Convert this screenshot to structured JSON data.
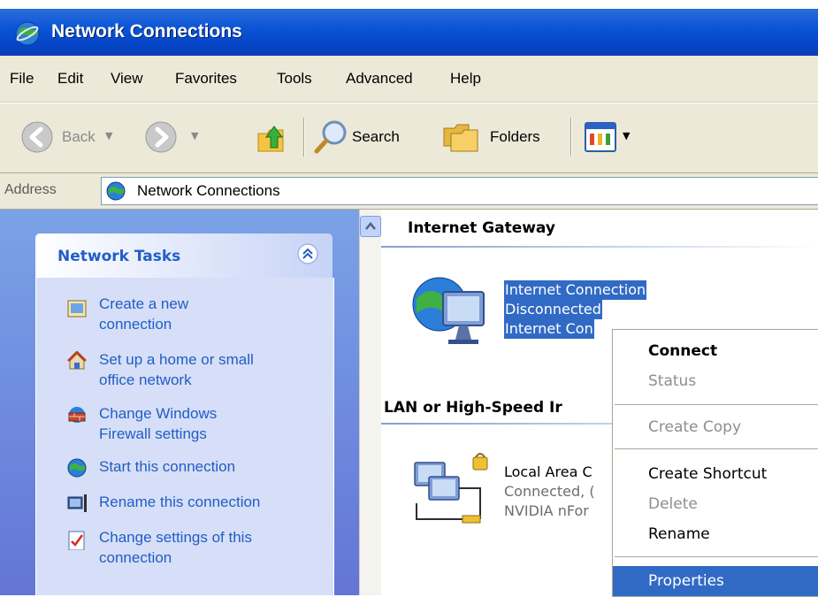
{
  "window": {
    "title": "Network Connections"
  },
  "menu": [
    "File",
    "Edit",
    "View",
    "Favorites",
    "Tools",
    "Advanced",
    "Help"
  ],
  "toolbar": {
    "back": "Back",
    "search": "Search",
    "folders": "Folders"
  },
  "address": {
    "label": "Address",
    "value": "Network Connections"
  },
  "tasks": {
    "title": "Network Tasks",
    "items": [
      {
        "line1": "Create a new",
        "line2": "connection"
      },
      {
        "line1": "Set up a home or small",
        "line2": "office network"
      },
      {
        "line1": "Change Windows",
        "line2": "Firewall settings"
      },
      {
        "line1": "Start this connection",
        "line2": ""
      },
      {
        "line1": "Rename this connection",
        "line2": ""
      },
      {
        "line1": "Change settings of this",
        "line2": "connection"
      }
    ]
  },
  "content": {
    "group1": "Internet Gateway",
    "gateway": {
      "line1": "Internet Connection",
      "line2": "Disconnected",
      "line3": "Internet Con"
    },
    "group2": "LAN or High-Speed Ir",
    "lan": {
      "line1": "Local Area C",
      "line2": "Connected, (",
      "line3": "NVIDIA nFor"
    }
  },
  "context_menu": {
    "connect": "Connect",
    "status": "Status",
    "create_copy": "Create Copy",
    "create_shortcut": "Create Shortcut",
    "delete": "Delete",
    "rename": "Rename",
    "properties": "Properties"
  },
  "colors": {
    "title_blue": "#0a55d6",
    "selection": "#316ac5",
    "task_link": "#215dc6",
    "panel_blue": "#7ba2e7"
  }
}
